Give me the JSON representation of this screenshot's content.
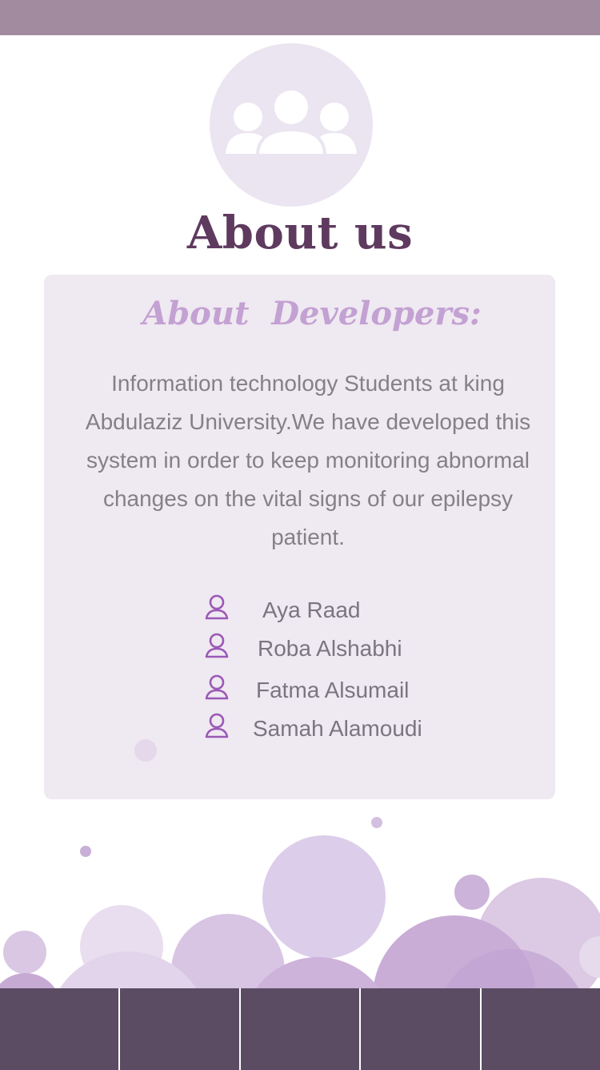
{
  "page": {
    "title": "About us"
  },
  "card": {
    "heading": "About  Developers:",
    "description": "Information technology Students at king Abdulaziz University.We have developed this system in order to keep monitoring abnormal changes on the vital signs of our epilepsy patient."
  },
  "developers": [
    {
      "name": "Aya Raad",
      "icon": "user-icon"
    },
    {
      "name": "Roba Alshabhi",
      "icon": "user-icon"
    },
    {
      "name": "Fatma Alsumail",
      "icon": "user-icon"
    },
    {
      "name": "Samah Alamoudi",
      "icon": "user-icon"
    }
  ],
  "icons": {
    "header": "team-icon",
    "developer": "user-icon"
  },
  "tab_bar": {
    "tab_count": 5
  },
  "colors": {
    "status_bar": "#a28b9f",
    "title": "#5f3a5f",
    "heading": "#c3a1d2",
    "card_bg": "#efe9f1",
    "tab_bar": "#5b4c64",
    "icon_accent": "#9b59b6"
  }
}
